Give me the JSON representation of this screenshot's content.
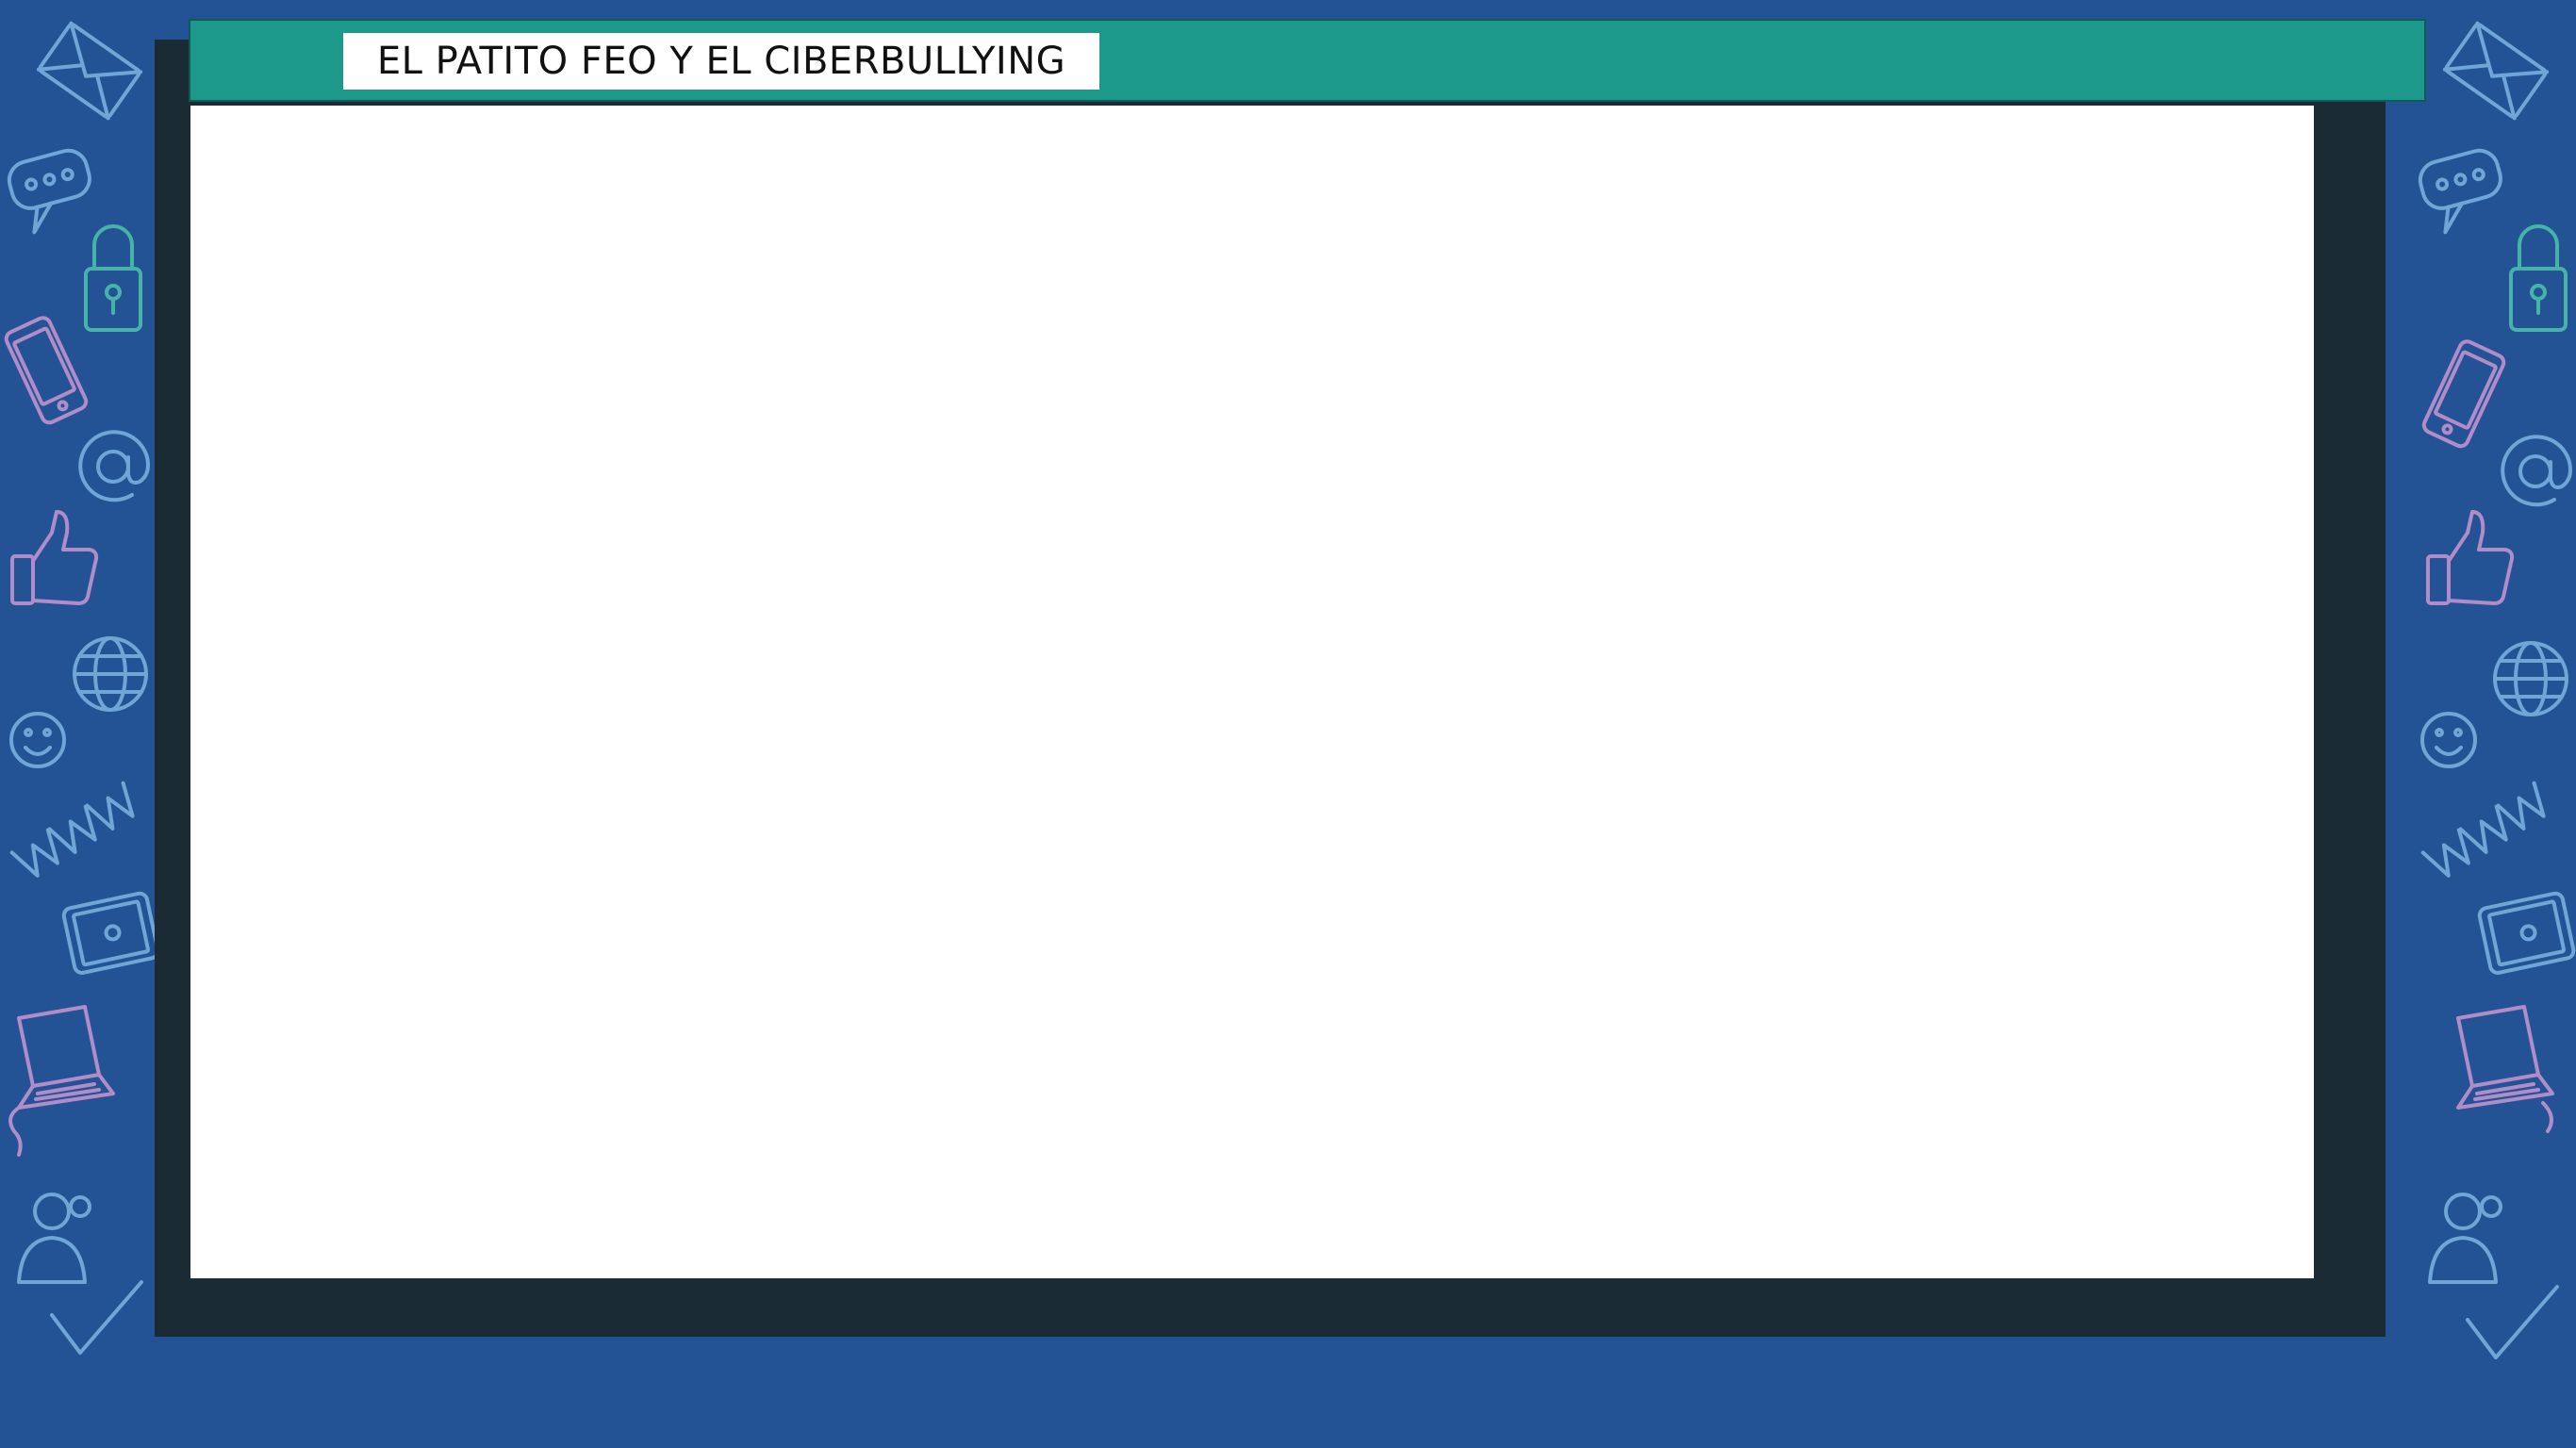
{
  "slide": {
    "title": "EL PATITO FEO Y EL CIBERBULLYING",
    "colors": {
      "background": "#235394",
      "frame": "#1b2b34",
      "header_bar": "#1d998b",
      "content": "#ffffff"
    }
  },
  "decorations": {
    "icons": [
      "envelope-icon",
      "speech-bubble-icon",
      "padlock-icon",
      "smartphone-icon",
      "at-sign-icon",
      "thumbs-up-icon",
      "globe-icon",
      "smiley-icon",
      "www-icon",
      "tablet-icon",
      "laptop-icon",
      "user-icon",
      "checkmark-icon"
    ]
  }
}
